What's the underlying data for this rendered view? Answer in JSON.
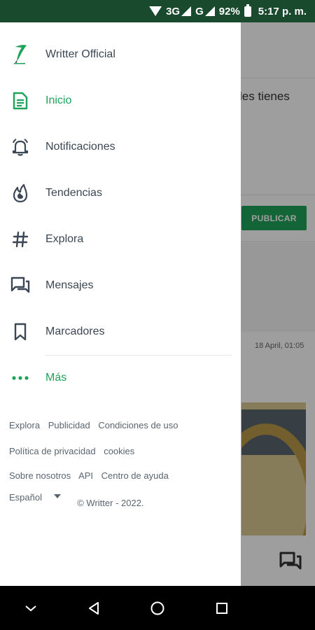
{
  "status_bar": {
    "network1": "3G",
    "network2": "G",
    "battery": "92%",
    "time": "5:17 p. m."
  },
  "background": {
    "hint_text": "les tienes",
    "publish_label": "PUBLICAR",
    "post_date": "18 April, 01:05"
  },
  "drawer": {
    "account": {
      "name": "Writter Official",
      "icon": "writter-logo-icon"
    },
    "items": [
      {
        "label": "Inicio",
        "icon": "document-icon",
        "active": true
      },
      {
        "label": "Notificaciones",
        "icon": "bell-icon"
      },
      {
        "label": "Tendencias",
        "icon": "flame-icon"
      },
      {
        "label": "Explora",
        "icon": "hash-icon"
      },
      {
        "label": "Mensajes",
        "icon": "messages-icon"
      },
      {
        "label": "Marcadores",
        "icon": "bookmark-icon"
      },
      {
        "label": "Más",
        "icon": "more-dots-icon",
        "active": true
      }
    ],
    "footer": {
      "row1": [
        "Explora",
        "Publicidad",
        "Condiciones de uso"
      ],
      "row2": [
        "Política de privacidad",
        "cookies"
      ],
      "row3": [
        "Sobre nosotros",
        "API",
        "Centro de ayuda"
      ],
      "language": "Español",
      "copyright": "© Writter - 2022."
    }
  },
  "colors": {
    "accent": "#1fa35b",
    "text": "#3b4754",
    "status_bar": "#1a4a2e"
  }
}
